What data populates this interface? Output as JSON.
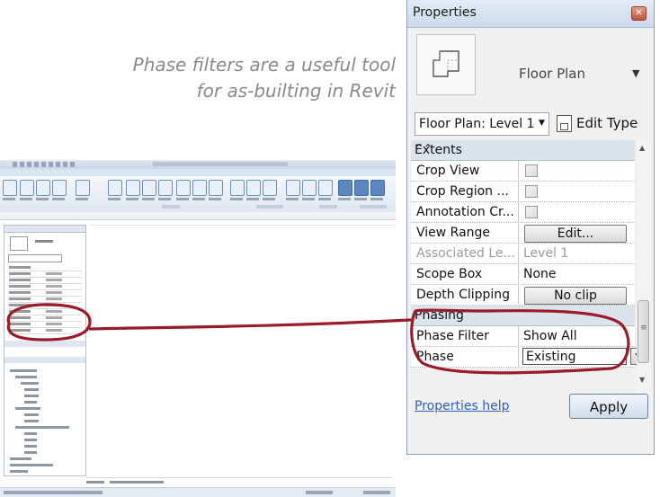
{
  "caption": {
    "line1": "Phase filters are a useful tool",
    "line2": "for as-builting in Revit"
  },
  "properties_panel": {
    "title": "Properties",
    "type_name": "Floor Plan",
    "instance_selector": "Floor Plan: Level 1",
    "edit_type_label": "Edit Type",
    "groups": {
      "extents": {
        "label": "Extents",
        "rows": {
          "crop_view": {
            "name": "Crop View"
          },
          "crop_region": {
            "name": "Crop Region ..."
          },
          "annotation_crop": {
            "name": "Annotation Cr..."
          },
          "view_range": {
            "name": "View Range",
            "value": "Edit..."
          },
          "associated_level": {
            "name": "Associated Le...",
            "value": "Level 1"
          },
          "scope_box": {
            "name": "Scope Box",
            "value": "None"
          },
          "depth_clipping": {
            "name": "Depth Clipping",
            "value": "No clip"
          }
        }
      },
      "phasing": {
        "label": "Phasing",
        "rows": {
          "phase_filter": {
            "name": "Phase Filter",
            "value": "Show All"
          },
          "phase": {
            "name": "Phase",
            "value": "Existing"
          }
        }
      }
    },
    "help_link": "Properties help",
    "apply_button": "Apply"
  },
  "colors": {
    "annotation": "#9b1b2a",
    "caption": "#8a8a8a",
    "link": "#2e5fb5"
  },
  "icons": {
    "close": "close-icon",
    "collapse": "double-chevron-up-icon",
    "dropdown": "dropdown-arrow-icon",
    "edit_type": "edit-type-icon",
    "floor_plan_thumbnail": "floor-plan-icon"
  }
}
